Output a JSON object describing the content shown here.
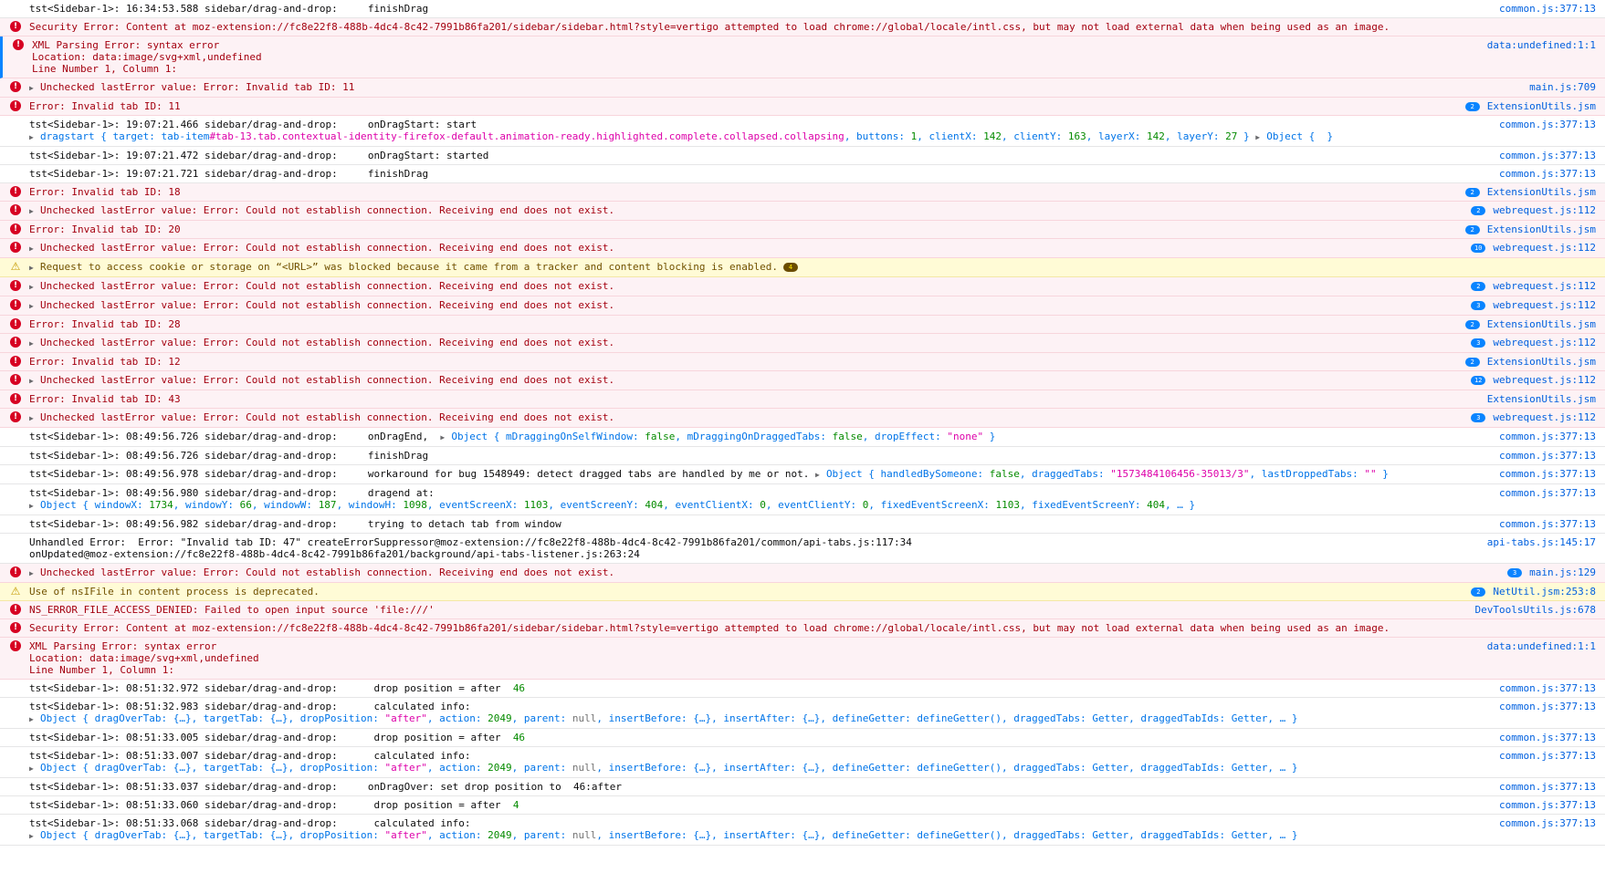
{
  "console": {
    "rows": [
      {
        "type": "log",
        "lines": [
          {
            "text": "tst<Sidebar-1>: 16:34:53.588 sidebar/drag-and-drop:     finishDrag"
          }
        ],
        "source": "common.js:377:13"
      },
      {
        "type": "error",
        "lines": [
          {
            "text": "Security Error: Content at moz-extension://fc8e22f8-488b-4dc4-8c42-7991b86fa201/sidebar/sidebar.html?style=vertigo attempted to load chrome://global/locale/intl.css, but may not load external data when being used as an image."
          }
        ]
      },
      {
        "type": "error",
        "marked": true,
        "lines": [
          {
            "text": "XML Parsing Error: syntax error"
          },
          {
            "text": "Location: data:image/svg+xml,undefined"
          },
          {
            "text": "Line Number 1, Column 1:"
          }
        ],
        "source": "data:undefined:1:1"
      },
      {
        "type": "error",
        "expandable": true,
        "lines": [
          {
            "text": "Unchecked lastError value: Error: Invalid tab ID: 11"
          }
        ],
        "source": "main.js:709"
      },
      {
        "type": "error",
        "lines": [
          {
            "text": "Error: Invalid tab ID: 11"
          }
        ],
        "badge": "2",
        "source": "ExtensionUtils.jsm"
      },
      {
        "type": "log",
        "lines": [
          {
            "text": "tst<Sidebar-1>: 19:07:21.466 sidebar/drag-and-drop:     onDragStart: start"
          },
          {
            "sub": true,
            "expandable": true,
            "parts": [
              [
                "obj",
                "dragstart { target: tab-item"
              ],
              [
                "str",
                "#tab-13.tab.contextual-identity-firefox-default.animation-ready.highlighted.complete.collapsed.collapsing"
              ],
              [
                "obj",
                ", buttons: "
              ],
              [
                "num",
                "1"
              ],
              [
                "obj",
                ", clientX: "
              ],
              [
                "num",
                "142"
              ],
              [
                "obj",
                ", clientY: "
              ],
              [
                "num",
                "163"
              ],
              [
                "obj",
                ", layerX: "
              ],
              [
                "num",
                "142"
              ],
              [
                "obj",
                ", layerY: "
              ],
              [
                "num",
                "27"
              ],
              [
                "obj",
                " } "
              ],
              [
                "arrow",
                "▶"
              ],
              [
                "obj",
                "Object {  }"
              ]
            ]
          }
        ],
        "source": "common.js:377:13"
      },
      {
        "type": "log",
        "lines": [
          {
            "text": "tst<Sidebar-1>: 19:07:21.472 sidebar/drag-and-drop:     onDragStart: started"
          }
        ],
        "source": "common.js:377:13"
      },
      {
        "type": "log",
        "lines": [
          {
            "text": "tst<Sidebar-1>: 19:07:21.721 sidebar/drag-and-drop:     finishDrag"
          }
        ],
        "source": "common.js:377:13"
      },
      {
        "type": "error",
        "lines": [
          {
            "text": "Error: Invalid tab ID: 18"
          }
        ],
        "badge": "2",
        "source": "ExtensionUtils.jsm"
      },
      {
        "type": "error",
        "expandable": true,
        "lines": [
          {
            "text": "Unchecked lastError value: Error: Could not establish connection. Receiving end does not exist."
          }
        ],
        "badge": "2",
        "source": "webrequest.js:112"
      },
      {
        "type": "error",
        "lines": [
          {
            "text": "Error: Invalid tab ID: 20"
          }
        ],
        "badge": "2",
        "source": "ExtensionUtils.jsm"
      },
      {
        "type": "error",
        "expandable": true,
        "lines": [
          {
            "text": "Unchecked lastError value: Error: Could not establish connection. Receiving end does not exist."
          }
        ],
        "badge": "10",
        "source": "webrequest.js:112"
      },
      {
        "type": "warning",
        "expandable": true,
        "lines": [
          {
            "text": "Request to access cookie or storage on “<URL>” was blocked because it came from a tracker and content blocking is enabled."
          }
        ],
        "inline_badge": "4"
      },
      {
        "type": "error",
        "expandable": true,
        "lines": [
          {
            "text": "Unchecked lastError value: Error: Could not establish connection. Receiving end does not exist."
          }
        ],
        "badge": "2",
        "source": "webrequest.js:112"
      },
      {
        "type": "error",
        "expandable": true,
        "lines": [
          {
            "text": "Unchecked lastError value: Error: Could not establish connection. Receiving end does not exist."
          }
        ],
        "badge": "3",
        "source": "webrequest.js:112"
      },
      {
        "type": "error",
        "lines": [
          {
            "text": "Error: Invalid tab ID: 28"
          }
        ],
        "badge": "2",
        "source": "ExtensionUtils.jsm"
      },
      {
        "type": "error",
        "expandable": true,
        "lines": [
          {
            "text": "Unchecked lastError value: Error: Could not establish connection. Receiving end does not exist."
          }
        ],
        "badge": "3",
        "source": "webrequest.js:112"
      },
      {
        "type": "error",
        "lines": [
          {
            "text": "Error: Invalid tab ID: 12"
          }
        ],
        "badge": "2",
        "source": "ExtensionUtils.jsm"
      },
      {
        "type": "error",
        "expandable": true,
        "lines": [
          {
            "text": "Unchecked lastError value: Error: Could not establish connection. Receiving end does not exist."
          }
        ],
        "badge": "12",
        "source": "webrequest.js:112"
      },
      {
        "type": "error",
        "lines": [
          {
            "text": "Error: Invalid tab ID: 43"
          }
        ],
        "source": "ExtensionUtils.jsm"
      },
      {
        "type": "error",
        "expandable": true,
        "lines": [
          {
            "text": "Unchecked lastError value: Error: Could not establish connection. Receiving end does not exist."
          }
        ],
        "badge": "3",
        "source": "webrequest.js:112"
      },
      {
        "type": "log",
        "lines": [
          {
            "parts": [
              [
                "txt",
                "tst<Sidebar-1>: 08:49:56.726 sidebar/drag-and-drop:     onDragEnd,  "
              ],
              [
                "arrow",
                "▶"
              ],
              [
                "obj",
                "Object { mDraggingOnSelfWindow: "
              ],
              [
                "num",
                "false"
              ],
              [
                "obj",
                ", mDraggingOnDraggedTabs: "
              ],
              [
                "num",
                "false"
              ],
              [
                "obj",
                ", dropEffect: "
              ],
              [
                "str",
                "\"none\""
              ],
              [
                "obj",
                " }"
              ]
            ]
          }
        ],
        "source": "common.js:377:13"
      },
      {
        "type": "log",
        "lines": [
          {
            "text": "tst<Sidebar-1>: 08:49:56.726 sidebar/drag-and-drop:     finishDrag"
          }
        ],
        "source": "common.js:377:13"
      },
      {
        "type": "log",
        "lines": [
          {
            "parts": [
              [
                "txt",
                "tst<Sidebar-1>: 08:49:56.978 sidebar/drag-and-drop:     workaround for bug 1548949: detect dragged tabs are handled by me or not. "
              ],
              [
                "arrow",
                "▶"
              ],
              [
                "obj",
                "Object { handledBySomeone: "
              ],
              [
                "num",
                "false"
              ],
              [
                "obj",
                ", draggedTabs: "
              ],
              [
                "str",
                "\"1573484106456-35013/3\""
              ],
              [
                "obj",
                ", lastDroppedTabs: "
              ],
              [
                "str",
                "\"\""
              ],
              [
                "obj",
                " }"
              ]
            ]
          }
        ],
        "source": "common.js:377:13"
      },
      {
        "type": "log",
        "lines": [
          {
            "text": "tst<Sidebar-1>: 08:49:56.980 sidebar/drag-and-drop:     dragend at:"
          },
          {
            "sub": true,
            "expandable": true,
            "parts": [
              [
                "obj",
                "Object { windowX: "
              ],
              [
                "num",
                "1734"
              ],
              [
                "obj",
                ", windowY: "
              ],
              [
                "num",
                "66"
              ],
              [
                "obj",
                ", windowW: "
              ],
              [
                "num",
                "187"
              ],
              [
                "obj",
                ", windowH: "
              ],
              [
                "num",
                "1098"
              ],
              [
                "obj",
                ", eventScreenX: "
              ],
              [
                "num",
                "1103"
              ],
              [
                "obj",
                ", eventScreenY: "
              ],
              [
                "num",
                "404"
              ],
              [
                "obj",
                ", eventClientX: "
              ],
              [
                "num",
                "0"
              ],
              [
                "obj",
                ", eventClientY: "
              ],
              [
                "num",
                "0"
              ],
              [
                "obj",
                ", fixedEventScreenX: "
              ],
              [
                "num",
                "1103"
              ],
              [
                "obj",
                ", fixedEventScreenY: "
              ],
              [
                "num",
                "404"
              ],
              [
                "obj",
                ", … }"
              ]
            ]
          }
        ],
        "source": "common.js:377:13"
      },
      {
        "type": "log",
        "lines": [
          {
            "text": "tst<Sidebar-1>: 08:49:56.982 sidebar/drag-and-drop:     trying to detach tab from window"
          }
        ],
        "source": "common.js:377:13"
      },
      {
        "type": "log",
        "lines": [
          {
            "text": "Unhandled Error:  Error: \"Invalid tab ID: 47\" createErrorSuppressor@moz-extension://fc8e22f8-488b-4dc4-8c42-7991b86fa201/common/api-tabs.js:117:34"
          },
          {
            "text": "onUpdated@moz-extension://fc8e22f8-488b-4dc4-8c42-7991b86fa201/background/api-tabs-listener.js:263:24"
          }
        ],
        "source": "api-tabs.js:145:17"
      },
      {
        "type": "error",
        "expandable": true,
        "lines": [
          {
            "text": "Unchecked lastError value: Error: Could not establish connection. Receiving end does not exist."
          }
        ],
        "badge": "3",
        "source": "main.js:129"
      },
      {
        "type": "warning",
        "lines": [
          {
            "text": "Use of nsIFile in content process is deprecated."
          }
        ],
        "badge": "2",
        "source": "NetUtil.jsm:253:8"
      },
      {
        "type": "error",
        "lines": [
          {
            "text": "NS_ERROR_FILE_ACCESS_DENIED: Failed to open input source 'file:///'"
          }
        ],
        "source": "DevToolsUtils.js:678"
      },
      {
        "type": "error",
        "lines": [
          {
            "text": "Security Error: Content at moz-extension://fc8e22f8-488b-4dc4-8c42-7991b86fa201/sidebar/sidebar.html?style=vertigo attempted to load chrome://global/locale/intl.css, but may not load external data when being used as an image."
          }
        ]
      },
      {
        "type": "error",
        "lines": [
          {
            "text": "XML Parsing Error: syntax error"
          },
          {
            "text": "Location: data:image/svg+xml,undefined"
          },
          {
            "text": "Line Number 1, Column 1:"
          }
        ],
        "source": "data:undefined:1:1"
      },
      {
        "type": "log",
        "lines": [
          {
            "parts": [
              [
                "txt",
                "tst<Sidebar-1>: 08:51:32.972 sidebar/drag-and-drop:      drop position = after  "
              ],
              [
                "num",
                "46"
              ]
            ]
          }
        ],
        "source": "common.js:377:13"
      },
      {
        "type": "log",
        "lines": [
          {
            "text": "tst<Sidebar-1>: 08:51:32.983 sidebar/drag-and-drop:      calculated info:"
          },
          {
            "sub": true,
            "expandable": true,
            "parts": [
              [
                "obj",
                "Object { dragOverTab: {…}, targetTab: {…}, dropPosition: "
              ],
              [
                "str",
                "\"after\""
              ],
              [
                "obj",
                ", action: "
              ],
              [
                "num",
                "2049"
              ],
              [
                "obj",
                ", parent: "
              ],
              [
                "nul",
                "null"
              ],
              [
                "obj",
                ", insertBefore: {…}, insertAfter: {…}, defineGetter: defineGetter(), draggedTabs: Getter, draggedTabIds: Getter, … }"
              ]
            ]
          }
        ],
        "source": "common.js:377:13"
      },
      {
        "type": "log",
        "lines": [
          {
            "parts": [
              [
                "txt",
                "tst<Sidebar-1>: 08:51:33.005 sidebar/drag-and-drop:      drop position = after  "
              ],
              [
                "num",
                "46"
              ]
            ]
          }
        ],
        "source": "common.js:377:13"
      },
      {
        "type": "log",
        "lines": [
          {
            "text": "tst<Sidebar-1>: 08:51:33.007 sidebar/drag-and-drop:      calculated info:"
          },
          {
            "sub": true,
            "expandable": true,
            "parts": [
              [
                "obj",
                "Object { dragOverTab: {…}, targetTab: {…}, dropPosition: "
              ],
              [
                "str",
                "\"after\""
              ],
              [
                "obj",
                ", action: "
              ],
              [
                "num",
                "2049"
              ],
              [
                "obj",
                ", parent: "
              ],
              [
                "nul",
                "null"
              ],
              [
                "obj",
                ", insertBefore: {…}, insertAfter: {…}, defineGetter: defineGetter(), draggedTabs: Getter, draggedTabIds: Getter, … }"
              ]
            ]
          }
        ],
        "source": "common.js:377:13"
      },
      {
        "type": "log",
        "lines": [
          {
            "text": "tst<Sidebar-1>: 08:51:33.037 sidebar/drag-and-drop:     onDragOver: set drop position to  46:after"
          }
        ],
        "source": "common.js:377:13"
      },
      {
        "type": "log",
        "lines": [
          {
            "parts": [
              [
                "txt",
                "tst<Sidebar-1>: 08:51:33.060 sidebar/drag-and-drop:      drop position = after  "
              ],
              [
                "num",
                "4"
              ]
            ]
          }
        ],
        "source": "common.js:377:13"
      },
      {
        "type": "log",
        "lines": [
          {
            "text": "tst<Sidebar-1>: 08:51:33.068 sidebar/drag-and-drop:      calculated info:"
          },
          {
            "sub": true,
            "expandable": true,
            "parts": [
              [
                "obj",
                "Object { dragOverTab: {…}, targetTab: {…}, dropPosition: "
              ],
              [
                "str",
                "\"after\""
              ],
              [
                "obj",
                ", action: "
              ],
              [
                "num",
                "2049"
              ],
              [
                "obj",
                ", parent: "
              ],
              [
                "nul",
                "null"
              ],
              [
                "obj",
                ", insertBefore: {…}, insertAfter: {…}, defineGetter: defineGetter(), draggedTabs: Getter, draggedTabIds: Getter, … }"
              ]
            ]
          }
        ],
        "source": "common.js:377:13"
      }
    ]
  }
}
